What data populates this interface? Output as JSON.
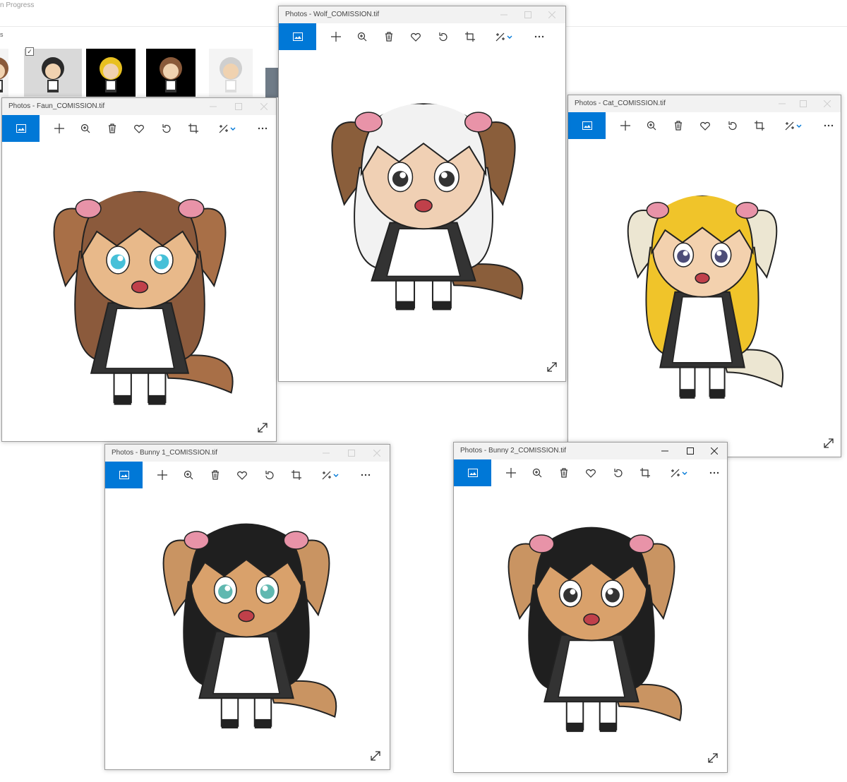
{
  "background": {
    "title_fragment": "n Progress",
    "label_fragment": "s",
    "thumbnails": [
      {
        "name": "thumb-faun-partial",
        "dark": false,
        "hair": "#8a5a3a"
      },
      {
        "name": "thumb-bunny2-selected",
        "dark": false,
        "hair": "#2a2a2a"
      },
      {
        "name": "thumb-cat",
        "dark": true,
        "hair": "#e8c020"
      },
      {
        "name": "thumb-faun",
        "dark": true,
        "hair": "#8a5a3a"
      },
      {
        "name": "thumb-sketch",
        "dark": false,
        "hair": "#cfcfcf"
      }
    ],
    "check_glyph": "✓"
  },
  "windows": {
    "wolf": {
      "title": "Photos - Wolf_COMISSION.tif"
    },
    "faun": {
      "title": "Photos - Faun_COMISSION.tif"
    },
    "cat": {
      "title": "Photos - Cat_COMISSION.tif"
    },
    "bunny1": {
      "title": "Photos - Bunny 1_COMISSION.tif"
    },
    "bunny2": {
      "title": "Photos - Bunny 2_COMISSION.tif"
    }
  },
  "toolbar_icons": [
    "photo-icon",
    "add-icon",
    "zoom-icon",
    "delete-icon",
    "favorite-icon",
    "rotate-icon",
    "crop-icon",
    "edit-icon",
    "more-icon"
  ],
  "colors": {
    "accent": "#0078d7",
    "titlebar": "#f2f2f2",
    "ribbon": "#e893a8"
  },
  "characters": {
    "faun": {
      "hair": "#8b5a3c",
      "ear": "#a86f47",
      "skin": "#e8b98a",
      "eye": "#46c0d8"
    },
    "wolf": {
      "hair": "#f2f2f2",
      "ear": "#8a5e3b",
      "skin": "#f0d0b4",
      "eye": "#333333"
    },
    "cat": {
      "hair": "#f0c42a",
      "ear": "#ece6d2",
      "skin": "#f3d1ae",
      "eye": "#4d4d78"
    },
    "bunny1": {
      "hair": "#1f1f1f",
      "ear": "#c99462",
      "skin": "#d9a16b",
      "eye": "#60b8b0"
    },
    "bunny2": {
      "hair": "#1f1f1f",
      "ear": "#c99462",
      "skin": "#d9a16b",
      "eye": "#333333"
    }
  }
}
